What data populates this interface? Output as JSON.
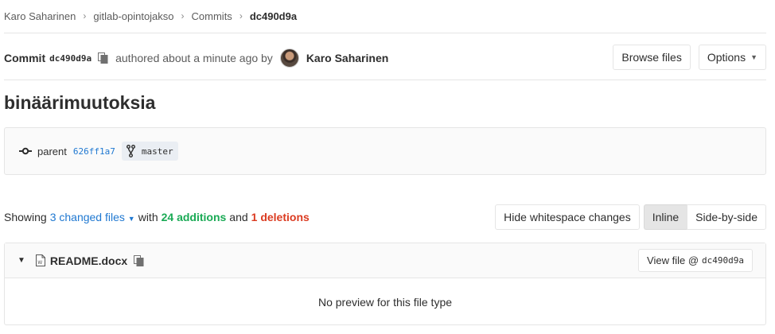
{
  "breadcrumb": {
    "items": [
      "Karo Saharinen",
      "gitlab-opintojakso",
      "Commits"
    ],
    "current": "dc490d9a"
  },
  "commit": {
    "label": "Commit",
    "sha": "dc490d9a",
    "authored_text": "authored about a minute ago by",
    "author": "Karo Saharinen",
    "title": "binäärimuutoksia",
    "parent_label": "parent",
    "parent_sha": "626ff1a7",
    "branch": "master"
  },
  "header_buttons": {
    "browse_files": "Browse files",
    "options": "Options"
  },
  "diff_summary": {
    "showing": "Showing",
    "changed_files": "3 changed files",
    "with": "with",
    "additions": "24 additions",
    "and": "and",
    "deletions": "1 deletions"
  },
  "diff_buttons": {
    "hide_whitespace": "Hide whitespace changes",
    "inline": "Inline",
    "side_by_side": "Side-by-side"
  },
  "file": {
    "name": "README.docx",
    "view_file_label": "View file @",
    "view_file_sha": "dc490d9a",
    "no_preview": "No preview for this file type"
  },
  "icons": {
    "copy": "copy-icon",
    "commit": "commit-icon",
    "branch": "branch-icon",
    "caret": "chevron-down-icon",
    "word_file": "word-file-icon"
  },
  "colors": {
    "link": "#1f78d1",
    "additions": "#1aaa55",
    "deletions": "#db3b21"
  }
}
